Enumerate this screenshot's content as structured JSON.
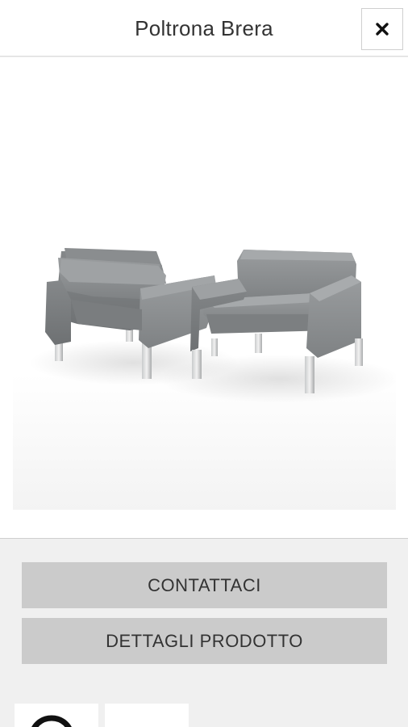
{
  "header": {
    "title": "Poltrona Brera",
    "close_icon": "close-icon"
  },
  "product": {
    "image_alt": "two-armchairs-image"
  },
  "actions": {
    "contact_label": "CONTATTACI",
    "details_label": "DETTAGLI PRODOTTO"
  },
  "thumbnails": [
    "thumbnail",
    "thumbnail"
  ],
  "colors": {
    "upholstery": "#8e9193",
    "button_bg": "#cbcbcb",
    "page_bg": "#f0f0f0"
  }
}
